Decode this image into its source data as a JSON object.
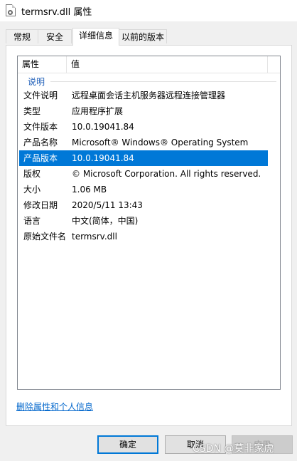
{
  "window": {
    "title": "termsrv.dll 属性"
  },
  "tabs": [
    {
      "label": "常规"
    },
    {
      "label": "安全"
    },
    {
      "label": "详细信息"
    },
    {
      "label": "以前的版本"
    }
  ],
  "details": {
    "column_property": "属性",
    "column_value": "值",
    "group": "说明",
    "rows": [
      {
        "key": "文件说明",
        "value": "远程桌面会话主机服务器远程连接管理器"
      },
      {
        "key": "类型",
        "value": "应用程序扩展"
      },
      {
        "key": "文件版本",
        "value": "10.0.19041.84"
      },
      {
        "key": "产品名称",
        "value": "Microsoft® Windows® Operating System"
      },
      {
        "key": "产品版本",
        "value": "10.0.19041.84"
      },
      {
        "key": "版权",
        "value": "© Microsoft Corporation. All rights reserved."
      },
      {
        "key": "大小",
        "value": "1.06 MB"
      },
      {
        "key": "修改日期",
        "value": "2020/5/11 13:43"
      },
      {
        "key": "语言",
        "value": "中文(简体，中国)"
      },
      {
        "key": "原始文件名",
        "value": "termsrv.dll"
      }
    ],
    "selected_row": "产品版本"
  },
  "footer": {
    "remove_link": "删除属性和个人信息",
    "ok": "确定",
    "cancel": "取消",
    "apply": "应用"
  },
  "watermark": "CSDN @莫非家虎",
  "colors": {
    "selection": "#0078d7",
    "link": "#0066cc",
    "group": "#1e5eb8"
  },
  "icons": {
    "app_icon": "dll-file-icon"
  }
}
